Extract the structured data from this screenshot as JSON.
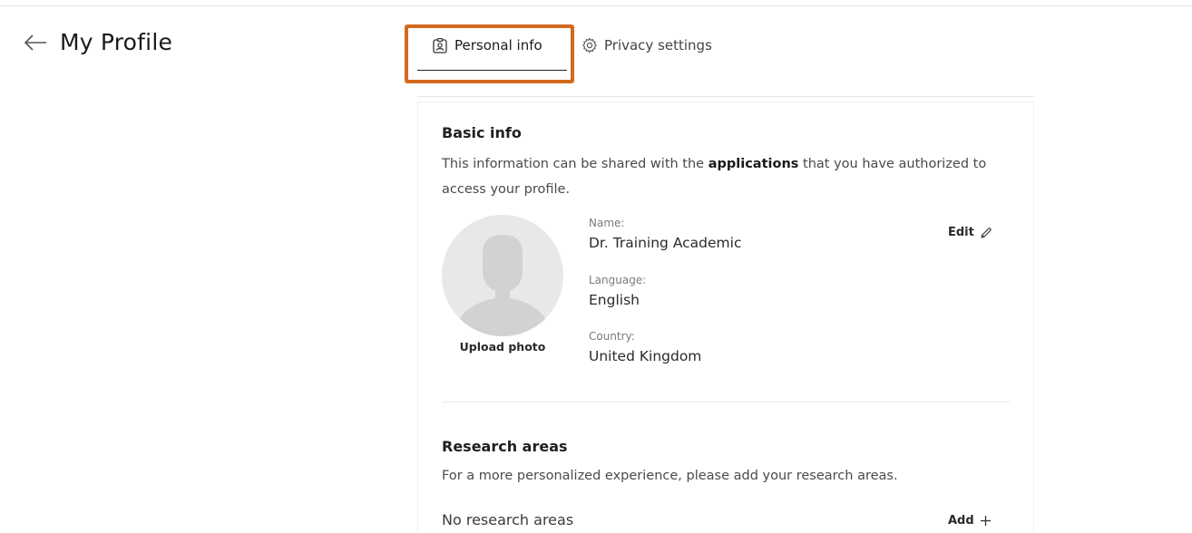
{
  "header": {
    "title": "My Profile",
    "back_icon": "arrow-left-icon"
  },
  "tabs": [
    {
      "label": "Personal info",
      "icon": "user-badge-icon",
      "active": true
    },
    {
      "label": "Privacy settings",
      "icon": "gear-icon",
      "active": false
    }
  ],
  "highlight_color": "#d2691e",
  "basic_info": {
    "title": "Basic info",
    "desc_before": "This information can be shared with the ",
    "desc_bold": "applications",
    "desc_after": " that you have authorized to access your profile.",
    "upload_label": "Upload photo",
    "edit_label": "Edit",
    "fields": {
      "name_label": "Name:",
      "name_value": "Dr. Training Academic",
      "language_label": "Language:",
      "language_value": "English",
      "country_label": "Country:",
      "country_value": "United Kingdom"
    }
  },
  "research_areas": {
    "title": "Research areas",
    "desc": "For a more personalized experience, please add your research areas.",
    "empty_text": "No research areas",
    "add_label": "Add"
  }
}
